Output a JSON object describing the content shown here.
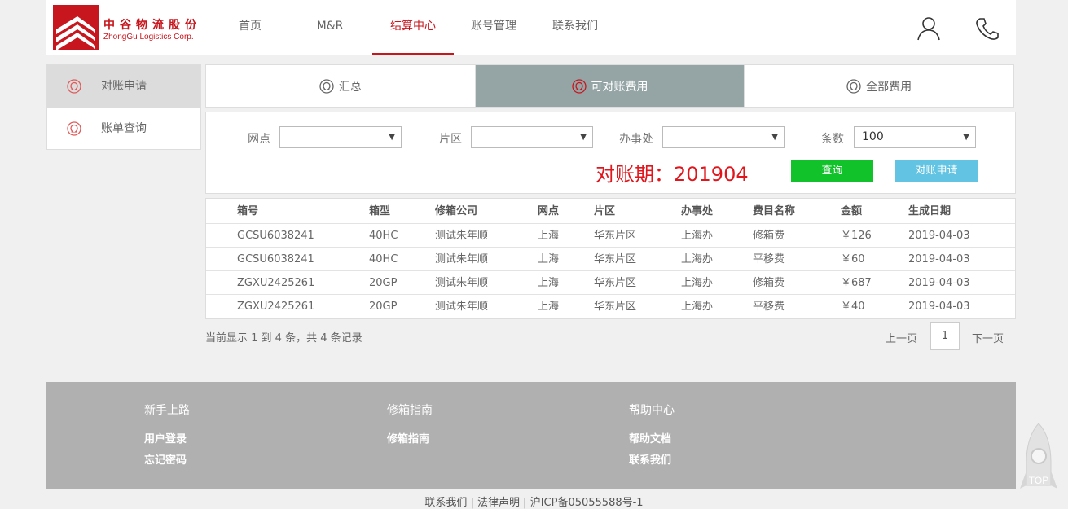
{
  "header": {
    "logo_cn": "中谷物流股份",
    "logo_en": "ZhongGu Logistics Corp.",
    "nav": [
      {
        "label": "首页"
      },
      {
        "label": "M&R"
      },
      {
        "label": "结算中心"
      },
      {
        "label": "账号管理"
      },
      {
        "label": "联系我们"
      }
    ],
    "active_nav": "结算中心",
    "icons": [
      "user-icon",
      "phone-icon"
    ]
  },
  "sidebar": {
    "items": [
      {
        "label": "对账申请",
        "icon": "omega-icon"
      },
      {
        "label": "账单查询",
        "icon": "omega-icon"
      }
    ],
    "active": "对账申请"
  },
  "tabs": {
    "items": [
      {
        "label": "汇总"
      },
      {
        "label": "可对账费用"
      },
      {
        "label": "全部费用"
      }
    ],
    "active": "可对账费用"
  },
  "filters": {
    "station_label": "网点",
    "station_value": "",
    "area_label": "片区",
    "area_value": "",
    "office_label": "办事处",
    "office_value": "",
    "count_label": "条数",
    "count_value": "100"
  },
  "period_text": "对账期：201904",
  "buttons": {
    "query": "查询",
    "apply": "对账申请"
  },
  "table": {
    "headers": [
      "箱号",
      "箱型",
      "修箱公司",
      "网点",
      "片区",
      "办事处",
      "费目名称",
      "金额",
      "生成日期"
    ],
    "rows": [
      [
        "GCSU6038241",
        "40HC",
        "测试朱年顺",
        "上海",
        "华东片区",
        "上海办",
        "修箱费",
        "￥126",
        "2019-04-03"
      ],
      [
        "GCSU6038241",
        "40HC",
        "测试朱年顺",
        "上海",
        "华东片区",
        "上海办",
        "平移费",
        "￥60",
        "2019-04-03"
      ],
      [
        "ZGXU2425261",
        "20GP",
        "测试朱年顺",
        "上海",
        "华东片区",
        "上海办",
        "修箱费",
        "￥687",
        "2019-04-03"
      ],
      [
        "ZGXU2425261",
        "20GP",
        "测试朱年顺",
        "上海",
        "华东片区",
        "上海办",
        "平移费",
        "￥40",
        "2019-04-03"
      ]
    ]
  },
  "pagination": {
    "summary": "当前显示 1 到 4 条，共 4 条记录",
    "prev": "上一页",
    "current": "1",
    "next": "下一页"
  },
  "footer": {
    "cols": [
      {
        "title": "新手上路",
        "links": [
          "用户登录",
          "忘记密码"
        ]
      },
      {
        "title": "修箱指南",
        "links": [
          "修箱指南"
        ]
      },
      {
        "title": "帮助中心",
        "links": [
          "帮助文档",
          "联系我们"
        ]
      }
    ],
    "bottom": "联系我们 | 法律声明 | 沪ICP备05055588号-1",
    "top_label": "TOP"
  },
  "colors": {
    "brand": "#c7161d",
    "tab_active": "#95a5a6",
    "query_btn": "#12c22b",
    "apply_btn": "#62c4e2",
    "footer": "#b0b0b0"
  }
}
